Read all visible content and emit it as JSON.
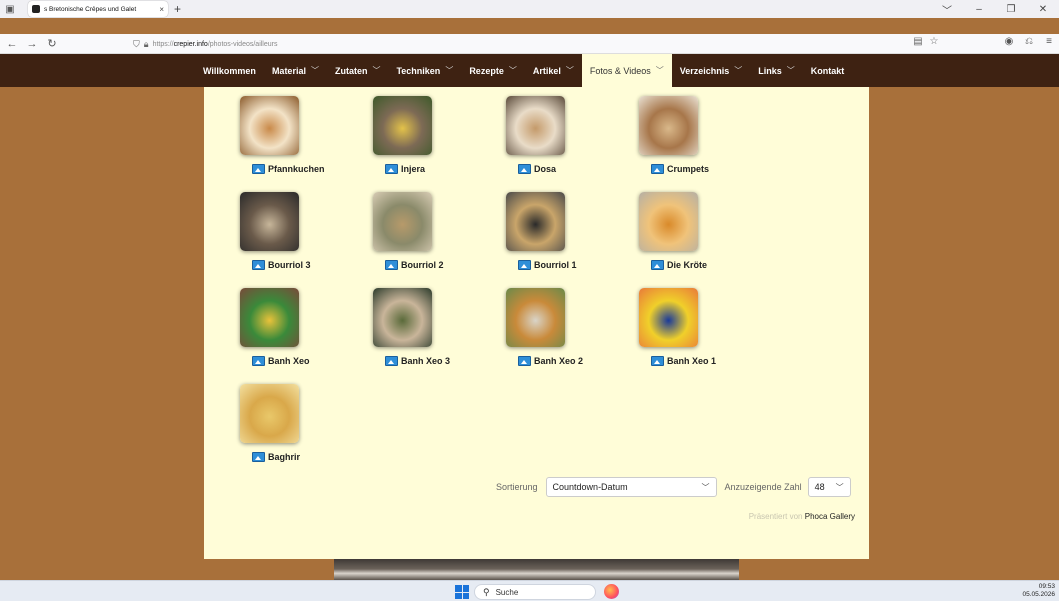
{
  "browser": {
    "tab_title": "s Bretonische Crêpes und Galet",
    "tab_close": "×",
    "new_tab": "+",
    "url_prefix": "https://",
    "url_domain": "crepier.info",
    "url_path": "/photos-videos/ailleurs"
  },
  "menu": [
    {
      "label": "Willkommen",
      "has_dropdown": false,
      "active": false
    },
    {
      "label": "Material",
      "has_dropdown": true,
      "active": false
    },
    {
      "label": "Zutaten",
      "has_dropdown": true,
      "active": false
    },
    {
      "label": "Techniken",
      "has_dropdown": true,
      "active": false
    },
    {
      "label": "Rezepte",
      "has_dropdown": true,
      "active": false
    },
    {
      "label": "Artikel",
      "has_dropdown": true,
      "active": false
    },
    {
      "label": "Fotos & Videos",
      "has_dropdown": true,
      "active": true
    },
    {
      "label": "Verzeichnis",
      "has_dropdown": true,
      "active": false
    },
    {
      "label": "Links",
      "has_dropdown": true,
      "active": false
    },
    {
      "label": "Kontakt",
      "has_dropdown": false,
      "active": false
    }
  ],
  "gallery": [
    {
      "label": "Pfannkuchen",
      "colors": [
        "#c98a4a",
        "#f3e3c7",
        "#8a5a2a"
      ]
    },
    {
      "label": "Injera",
      "colors": [
        "#e3c24a",
        "#7d6a55",
        "#3e5a2a"
      ]
    },
    {
      "label": "Dosa",
      "colors": [
        "#c49a6a",
        "#e9dcc8",
        "#5a4a3a"
      ]
    },
    {
      "label": "Crumpets",
      "colors": [
        "#d9b88a",
        "#a7764a",
        "#e9e1d3"
      ]
    },
    {
      "label": "Bourriol 3",
      "colors": [
        "#c7b69a",
        "#6a5a4a",
        "#2a2a2a"
      ]
    },
    {
      "label": "Bourriol 2",
      "colors": [
        "#b79a6a",
        "#8a8a6a",
        "#d9cdb5"
      ]
    },
    {
      "label": "Bourriol 1",
      "colors": [
        "#2a2a2a",
        "#c9a56a",
        "#4a4a4a"
      ]
    },
    {
      "label": "Die Kröte",
      "colors": [
        "#d98a2a",
        "#f0c37a",
        "#b5b0a5"
      ]
    },
    {
      "label": "Banh Xeo",
      "colors": [
        "#e9c23a",
        "#3a8a3a",
        "#7a4a3a"
      ]
    },
    {
      "label": "Banh Xeo 3",
      "colors": [
        "#5a6a3a",
        "#c9b59a",
        "#2a3a2a"
      ]
    },
    {
      "label": "Banh Xeo 2",
      "colors": [
        "#d9d4c8",
        "#c98a3a",
        "#6a8a4a"
      ]
    },
    {
      "label": "Banh Xeo 1",
      "colors": [
        "#1a3a9a",
        "#f0d02a",
        "#e97a3a"
      ]
    },
    {
      "label": "Baghrir",
      "colors": [
        "#e9c86a",
        "#d9a84a",
        "#f3e0a0"
      ]
    }
  ],
  "sort": {
    "label": "Sortierung",
    "value": "Countdown-Datum",
    "count_label": "Anzuzeigende Zahl",
    "count_value": "48"
  },
  "powered": {
    "prefix": "Präsentiert von",
    "brand": "Phoca Gallery"
  },
  "taskbar": {
    "search_placeholder": "Suche",
    "time": "09:53",
    "date": "05.05.2026"
  }
}
